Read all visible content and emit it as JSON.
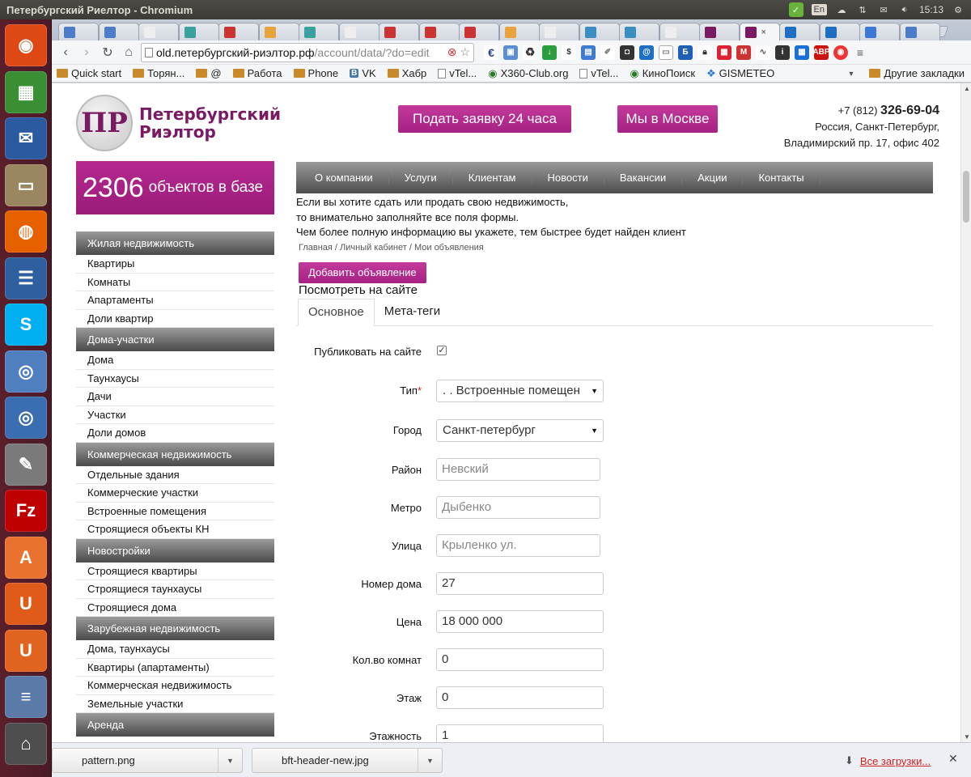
{
  "panel": {
    "title": "Петербургский Риелтор - Chromium",
    "lang": "En",
    "time": "15:13"
  },
  "launcher": [
    {
      "name": "ubuntu-dash-icon",
      "color": "#dd4814",
      "glyph": "◉"
    },
    {
      "name": "spreadsheet-app-icon",
      "color": "#3a8f35",
      "glyph": "▦"
    },
    {
      "name": "thunderbird-icon",
      "color": "#2c5aa0",
      "glyph": "✉"
    },
    {
      "name": "file-manager-icon",
      "color": "#9a8660",
      "glyph": "▭"
    },
    {
      "name": "firefox-icon",
      "color": "#e66000",
      "glyph": "◍"
    },
    {
      "name": "writer-app-icon",
      "color": "#2f5f9e",
      "glyph": "☰"
    },
    {
      "name": "skype-icon",
      "color": "#00aff0",
      "glyph": "S"
    },
    {
      "name": "chromium-icon",
      "color": "#4f7fbf",
      "glyph": "◎"
    },
    {
      "name": "chromium-alt-icon",
      "color": "#3b6db2",
      "glyph": "◎"
    },
    {
      "name": "text-editor-icon",
      "color": "#7a7a7a",
      "glyph": "✎"
    },
    {
      "name": "filezilla-icon",
      "color": "#bf0000",
      "glyph": "Fz"
    },
    {
      "name": "software-center-icon",
      "color": "#e8722e",
      "glyph": "A"
    },
    {
      "name": "u-app-icon",
      "color": "#e05a1a",
      "glyph": "U"
    },
    {
      "name": "u-headset-app-icon",
      "color": "#e0631f",
      "glyph": "U"
    },
    {
      "name": "misc-app-icon",
      "color": "#5b7aa8",
      "glyph": "≡"
    },
    {
      "name": "trash-icon",
      "color": "#4e4e4e",
      "glyph": "⌂"
    }
  ],
  "browser": {
    "url_host": "old.петербургский-риэлтор.рф",
    "url_path": "/account/data/?do=edit",
    "bookmarks": [
      {
        "label": "Quick start",
        "kind": "folder"
      },
      {
        "label": "Торян...",
        "kind": "folder"
      },
      {
        "label": "@",
        "kind": "folder"
      },
      {
        "label": "Работа",
        "kind": "folder"
      },
      {
        "label": "Phone",
        "kind": "folder"
      },
      {
        "label": "VK",
        "kind": "vk"
      },
      {
        "label": "Хабр",
        "kind": "folder"
      },
      {
        "label": "vTel...",
        "kind": "page"
      },
      {
        "label": "X360-Club.org",
        "kind": "globe"
      },
      {
        "label": "vTel...",
        "kind": "page"
      },
      {
        "label": "КиноПоиск",
        "kind": "globe"
      },
      {
        "label": "GISMETEO",
        "kind": "gis"
      }
    ],
    "other_bookmarks": "Другие закладки"
  },
  "site": {
    "logo_mark": "ПР",
    "logo_line1": "Петербургский",
    "logo_line2": "Риэлтор",
    "btn_request": "Подать заявку 24 часа",
    "btn_moscow": "Мы в Москве",
    "phone_prefix": "+7 (812)",
    "phone_number": "326-69-04",
    "address_line1": "Россия, Санкт-Петербург,",
    "address_line2": "Владимирский пр. 17, офис 402",
    "counter_number": "2306",
    "counter_label": "объектов в базе",
    "menu": [
      "О компании",
      "Услуги",
      "Клиентам",
      "Новости",
      "Вакансии",
      "Акции",
      "Контакты"
    ]
  },
  "sidebar": [
    {
      "heading": "Жилая недвижимость",
      "items": [
        "Квартиры",
        "Комнаты",
        "Апартаменты",
        "Доли квартир"
      ]
    },
    {
      "heading": "Дома-участки",
      "items": [
        "Дома",
        "Таунхаусы",
        "Дачи",
        "Участки",
        "Доли домов"
      ]
    },
    {
      "heading": "Коммерческая недвижимость",
      "items": [
        "Отдельные здания",
        "Коммерческие участки",
        "Встроенные помещения",
        "Строящиеся объекты КН"
      ]
    },
    {
      "heading": "Новостройки",
      "items": [
        "Строящиеся квартиры",
        "Строящиеся таунхаусы",
        "Строящиеся дома"
      ]
    },
    {
      "heading": "Зарубежная недвижимость",
      "items": [
        "Дома, таунхаусы",
        "Квартиры (апартаменты)",
        "Коммерческая недвижимость",
        "Земельные участки"
      ]
    },
    {
      "heading": "Аренда",
      "items": []
    }
  ],
  "content": {
    "intro_line1": "Если вы хотите сдать или продать свою недвижимость,",
    "intro_line2": "то внимательно заполняйте все поля формы.",
    "intro_line3": "Чем более полную информацию вы укажете, тем быстрее будет найден клиент",
    "breadcrumb": "Главная / Личный кабинет / Мои объявления",
    "add_button": "Добавить объявление",
    "view_on_site": "Посмотреть на сайте",
    "tab_main": "Основное",
    "tab_meta": "Мета-теги"
  },
  "form": {
    "publish_label": "Публиковать на сайте",
    "publish_checked": true,
    "type_label": "Тип",
    "type_required": "*",
    "type_value": ". . Встроенные помещен",
    "city_label": "Город",
    "city_value": "Санкт-петербург",
    "district_label": "Район",
    "district_placeholder": "Невский",
    "metro_label": "Метро",
    "metro_placeholder": "Дыбенко",
    "street_label": "Улица",
    "street_placeholder": "Крыленко ул.",
    "house_label": "Номер дома",
    "house_value": "27",
    "price_label": "Цена",
    "price_value": "18 000 000",
    "rooms_label": "Кол.во комнат",
    "rooms_value": "0",
    "floor_label": "Этаж",
    "floor_value": "0",
    "floors_label": "Этажность",
    "floors_value": "1"
  },
  "downloads": {
    "item1": "pattern.png",
    "item2": "bft-header-new.jpg",
    "all": "Все загрузки..."
  },
  "colors": {
    "brand": "#a52183",
    "menu_dark": "#4d4d4d"
  }
}
